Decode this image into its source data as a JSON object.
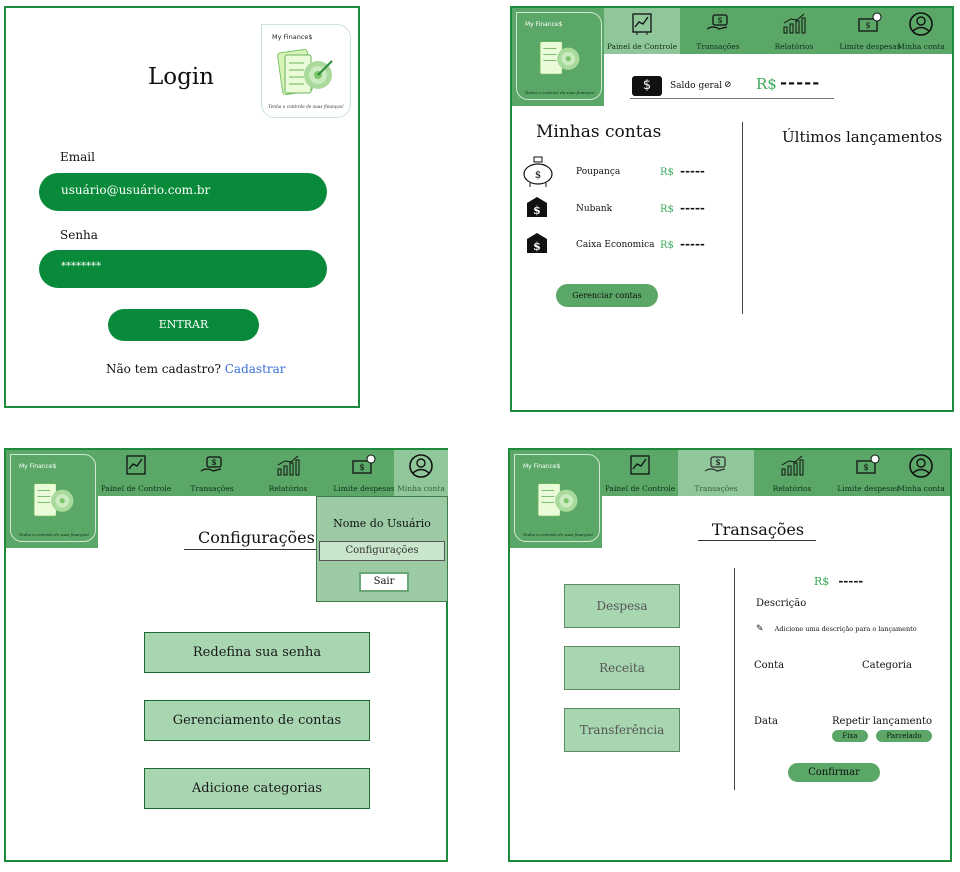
{
  "login": {
    "title": "Login",
    "email_label": "Email",
    "email_value": "usuário@usuário.com.br",
    "password_label": "Senha",
    "password_value": "********",
    "submit_label": "ENTRAR",
    "signup_prompt": "Não tem cadastro?",
    "signup_link": "Cadastrar"
  },
  "brand": {
    "name": "My Finance$",
    "tagline": "Tenha o controle de suas finanças!"
  },
  "nav": {
    "dashboard": "Painel de Controle",
    "transactions": "Transações",
    "reports": "Relatórios",
    "limits": "Limite despesas",
    "account": "Minha conta"
  },
  "dashboard": {
    "balance_label": "Saldo geral",
    "currency": "R$",
    "masked": "-----",
    "accounts_title": "Minhas contas",
    "latest_title": "Últimos lançamentos",
    "accounts": [
      {
        "name": "Poupança",
        "icon": "piggy-bank-icon"
      },
      {
        "name": "Nubank",
        "icon": "bank-icon"
      },
      {
        "name": "Caixa Economica",
        "icon": "bank-icon"
      }
    ],
    "manage_button": "Gerenciar contas"
  },
  "settings": {
    "title": "Configurações",
    "menu_user": "Nome do Usuário",
    "menu_settings": "Configurações",
    "menu_logout": "Sair",
    "options": [
      "Redefina sua senha",
      "Gerenciamento de contas",
      "Adicione categorias"
    ]
  },
  "transactions": {
    "title": "Transações",
    "types": [
      "Despesa",
      "Receita",
      "Transferência"
    ],
    "currency": "R$",
    "masked": "-----",
    "description_label": "Descrição",
    "description_placeholder": "Adicione uma descrição para o lançamento",
    "account_label": "Conta",
    "category_label": "Categoria",
    "date_label": "Data",
    "repeat_label": "Repetir lançamento",
    "repeat_fixed": "Fixa",
    "repeat_installments": "Parcelado",
    "confirm_button": "Confirmar"
  },
  "colors": {
    "primary": "#088a3a",
    "nav": "#5aa767",
    "nav_active": "#8fc79a",
    "soft_button": "#a8d6b1",
    "link": "#3a6fd8",
    "amount": "#3aa857"
  }
}
